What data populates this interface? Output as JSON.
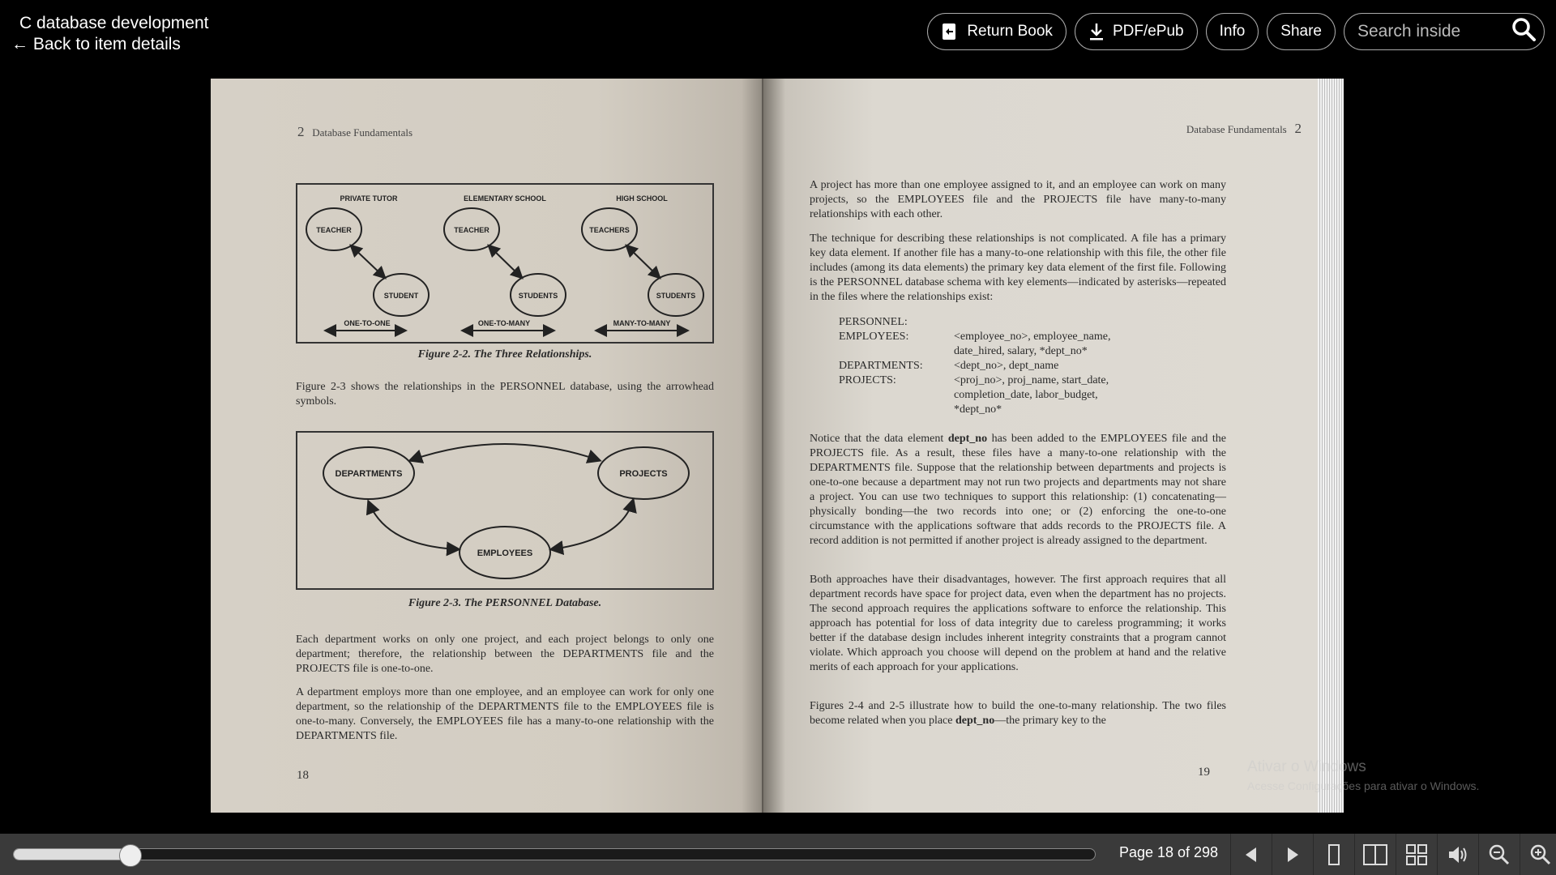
{
  "header": {
    "book_title": "C database development",
    "back_link": "← Back to item details"
  },
  "actions": {
    "return_book": "Return Book",
    "download": "PDF/ePub",
    "info": "Info",
    "share": "Share",
    "search_placeholder": "Search inside"
  },
  "left_page": {
    "running_head_num": "2",
    "running_head": "Database Fundamentals",
    "figure1": {
      "columns": [
        "PRIVATE TUTOR",
        "ELEMENTARY SCHOOL",
        "HIGH SCHOOL"
      ],
      "top_nodes": [
        "TEACHER",
        "TEACHER",
        "TEACHERS"
      ],
      "bottom_nodes": [
        "STUDENT",
        "STUDENTS",
        "STUDENTS"
      ],
      "relations": [
        "ONE-TO-ONE",
        "ONE-TO-MANY",
        "MANY-TO-MANY"
      ],
      "caption": "Figure 2-2.  The Three Relationships."
    },
    "para1": "Figure 2-3 shows the relationships in the PERSONNEL database, using the arrowhead symbols.",
    "figure2": {
      "nodes": [
        "DEPARTMENTS",
        "PROJECTS",
        "EMPLOYEES"
      ],
      "caption": "Figure 2-3.  The PERSONNEL Database."
    },
    "para2": "Each department works on only one project, and each project belongs to only one department; therefore, the relationship between the DEPARTMENTS file and the PROJECTS file is one-to-one.",
    "para3": "A department employs more than one employee, and an employee can work for only one department, so the relationship of the DEPARTMENTS file to the EMPLOYEES file is one-to-many. Conversely, the EMPLOYEES file has a many-to-one relationship with the DEPARTMENTS file.",
    "page_number": "18"
  },
  "right_page": {
    "running_head": "Database Fundamentals",
    "running_head_num": "2",
    "para1": "A project has more than one employee assigned to it, and an employee can work on many projects, so the EMPLOYEES file and the PROJECTS file have many-to-many relationships with each other.",
    "para2": "The technique for describing these relationships is not complicated. A file has a primary key data element. If another file has a many-to-one relationship with this file, the other file includes (among its data elements) the primary key data element of the first file. Following is the PERSONNEL database schema with key elements—indicated by asterisks—repeated in the files where the relationships exist:",
    "schema": [
      {
        "key": "PERSONNEL:",
        "value": ""
      },
      {
        "key": "EMPLOYEES:",
        "value": "<employee_no>, employee_name,"
      },
      {
        "key": "",
        "value": "date_hired, salary, *dept_no*"
      },
      {
        "key": "DEPARTMENTS:",
        "value": "<dept_no>, dept_name"
      },
      {
        "key": "PROJECTS:",
        "value": "<proj_no>, proj_name, start_date,"
      },
      {
        "key": "",
        "value": "completion_date, labor_budget,"
      },
      {
        "key": "",
        "value": "*dept_no*"
      }
    ],
    "para3_pre": "Notice that the data element ",
    "para3_bold": "dept_no",
    "para3_post": " has been added to the EMPLOYEES file and the PROJECTS file. As a result, these files have a many-to-one relationship with the DEPARTMENTS file. Suppose that the relationship between departments and projects is one-to-one because a department may not run two projects and departments may not share a project. You can use two techniques to support this relationship: (1) concatenating—physically bonding—the two records into one; or (2) enforcing the one-to-one circumstance with the applications software that adds records to the PROJECTS file. A record addition is not permitted if another project is already assigned to the department.",
    "para4": "Both approaches have their disadvantages, however. The first approach requires that all department records have space for project data, even when the department has no projects. The second approach requires the applications software to enforce the relationship. This approach has potential for loss of data integrity due to careless programming; it works better if the database design includes inherent integrity constraints that a program cannot violate. Which approach you choose will depend on the problem at hand and the relative merits of each approach for your applications.",
    "para5_pre": "Figures 2-4 and 2-5 illustrate how to build the one-to-many relationship. The two files become related when you place ",
    "para5_bold": "dept_no",
    "para5_post": "—the primary key to the",
    "page_number": "19"
  },
  "watermark": {
    "line1": "Ativar o Windows",
    "line2": "Acesse Configurações para ativar o Windows."
  },
  "footer": {
    "page_indicator": "Page 18 of 298",
    "progress_fraction": 0.108
  },
  "icons": {
    "return_book": "return-book-icon",
    "download": "download-icon",
    "search": "search-icon",
    "prev": "triangle-left-icon",
    "next": "triangle-right-icon",
    "single_page": "single-page-icon",
    "two_page": "two-page-icon",
    "thumbnails": "grid-icon",
    "read_aloud": "speaker-icon",
    "zoom_out": "zoom-out-icon",
    "zoom_in": "zoom-in-icon"
  }
}
